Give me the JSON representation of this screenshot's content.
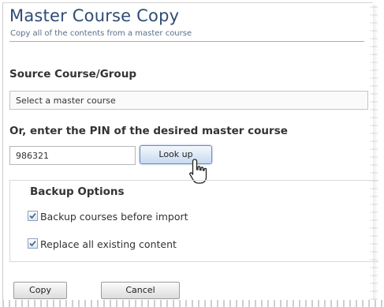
{
  "header": {
    "title": "Master Course Copy",
    "subtitle": "Copy all of the contents from a master course"
  },
  "source": {
    "label": "Source Course/Group",
    "select_value": "Select a master course"
  },
  "pin": {
    "label": "Or, enter the PIN of the desired master course",
    "value": "986321",
    "lookup_label": "Look up"
  },
  "backup": {
    "title": "Backup Options",
    "options": [
      {
        "label": "Backup courses before import",
        "checked": true
      },
      {
        "label": "Replace all existing content",
        "checked": true
      }
    ]
  },
  "actions": {
    "copy_label": "Copy",
    "cancel_label": "Cancel"
  },
  "colors": {
    "title": "#2e4d74",
    "accent_border": "#6f8fb7"
  },
  "icons": [
    "hand-pointer-icon",
    "checkmark-icon"
  ]
}
